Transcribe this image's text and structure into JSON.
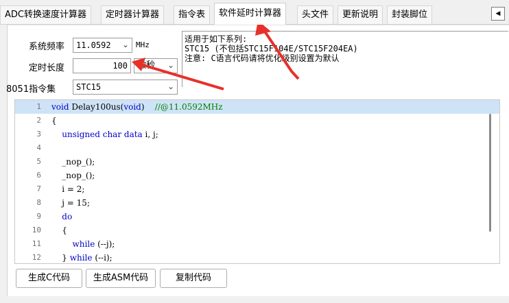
{
  "tabs": [
    {
      "label": "ADC转换速度计算器",
      "active": false
    },
    {
      "label": "定时器计算器",
      "active": false
    },
    {
      "label": "指令表",
      "active": false
    },
    {
      "label": "软件延时计算器",
      "active": true
    },
    {
      "label": "头文件",
      "active": false
    },
    {
      "label": "更新说明",
      "active": false
    },
    {
      "label": "封装脚位",
      "active": false
    }
  ],
  "tab_scroll_icon": "left-arrow-icon",
  "settings": {
    "freq_label": "系统频率",
    "freq_value": "11.0592",
    "freq_unit": "MHz",
    "delay_label": "定时长度",
    "delay_value": "100",
    "delay_unit": "微秒",
    "isa_label": "8051指令集",
    "isa_value": "STC15"
  },
  "info": {
    "line1": "适用于如下系列:",
    "line2": "STC15 (不包括STC15F104E/STC15F204EA)",
    "line3": "注意: C语言代码请将优化级别设置为默认"
  },
  "code_lines": [
    {
      "n": "1",
      "indent": "",
      "parts": [
        {
          "t": "void",
          "c": "kw"
        },
        {
          "t": " Delay100us("
        },
        {
          "t": "void",
          "c": "kw"
        },
        {
          "t": ")    "
        },
        {
          "t": "//@11.0592MHz",
          "c": "cm"
        }
      ]
    },
    {
      "n": "2",
      "indent": "",
      "parts": [
        {
          "t": "{"
        }
      ]
    },
    {
      "n": "3",
      "indent": "    ",
      "parts": [
        {
          "t": "unsigned char data",
          "c": "kw"
        },
        {
          "t": " i, j;"
        }
      ]
    },
    {
      "n": "4",
      "indent": "",
      "parts": []
    },
    {
      "n": "5",
      "indent": "    ",
      "parts": [
        {
          "t": "_nop_();"
        }
      ]
    },
    {
      "n": "6",
      "indent": "    ",
      "parts": [
        {
          "t": "_nop_();"
        }
      ]
    },
    {
      "n": "7",
      "indent": "    ",
      "parts": [
        {
          "t": "i = 2;"
        }
      ]
    },
    {
      "n": "8",
      "indent": "    ",
      "parts": [
        {
          "t": "j = 15;"
        }
      ]
    },
    {
      "n": "9",
      "indent": "    ",
      "parts": [
        {
          "t": "do",
          "c": "kw"
        }
      ]
    },
    {
      "n": "10",
      "indent": "    ",
      "parts": [
        {
          "t": "{"
        }
      ]
    },
    {
      "n": "11",
      "indent": "        ",
      "parts": [
        {
          "t": "while",
          "c": "kw"
        },
        {
          "t": " (--j);"
        }
      ]
    },
    {
      "n": "12",
      "indent": "    ",
      "parts": [
        {
          "t": "} "
        },
        {
          "t": "while",
          "c": "kw"
        },
        {
          "t": " (--i);"
        }
      ]
    }
  ],
  "buttons": {
    "gen_c": "生成C代码",
    "gen_asm": "生成ASM代码",
    "copy": "复制代码"
  },
  "colors": {
    "keyword": "#0000c8",
    "comment": "#008000",
    "highlight_row": "#cfe3f7",
    "annotation_arrow": "#e8302a"
  }
}
